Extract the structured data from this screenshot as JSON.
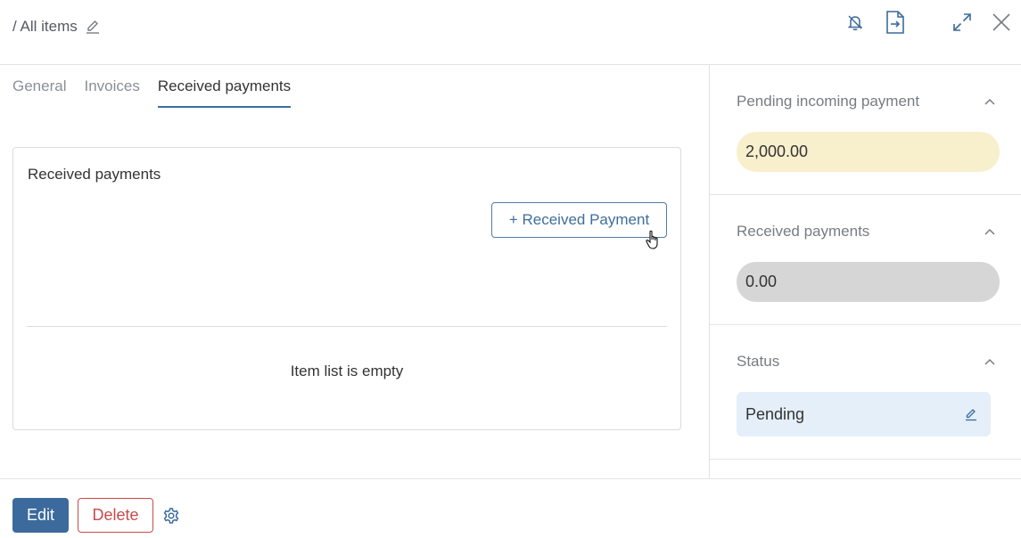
{
  "header": {
    "breadcrumb": "/ All items",
    "icons": [
      "edit-pencil-icon",
      "bell-off-icon",
      "export-document-icon",
      "expand-icon",
      "close-icon"
    ]
  },
  "tabs": [
    {
      "label": "General",
      "active": false
    },
    {
      "label": "Invoices",
      "active": false
    },
    {
      "label": "Received payments",
      "active": true
    }
  ],
  "card": {
    "title": "Received payments",
    "add_button": "+ Received Payment",
    "empty_text": "Item list is empty"
  },
  "side": {
    "pending": {
      "title": "Pending incoming payment",
      "value": "2,000.00"
    },
    "received": {
      "title": "Received payments",
      "value": "0.00"
    },
    "status": {
      "title": "Status",
      "value": "Pending"
    }
  },
  "footer": {
    "edit": "Edit",
    "delete": "Delete"
  },
  "colors": {
    "accent": "#3c6a9c",
    "danger": "#c74b4b",
    "pending_bg": "#f8efcd",
    "received_bg": "#d6d6d6",
    "status_bg": "#e4eff9"
  }
}
